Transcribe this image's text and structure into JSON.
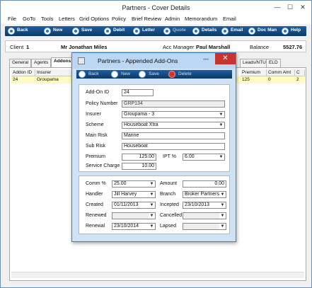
{
  "main_window": {
    "title": "Partners - Cover Details",
    "minimize_glyph": "—",
    "maximize_glyph": "☐",
    "close_glyph": "✕"
  },
  "menubar": [
    "File",
    "GoTo",
    "Tools",
    "Letters",
    "Grid Options",
    "Policy",
    "Brief Review",
    "Admin",
    "Memorandum",
    "Email"
  ],
  "toolbar": {
    "back": "Back",
    "new": "New",
    "save": "Save",
    "debit": "Debit",
    "letter": "Letter",
    "quote": "Quote",
    "details": "Details",
    "email": "Email",
    "doc_man": "Doc Man",
    "help": "Help"
  },
  "client_bar": {
    "client_label": "Client",
    "client_no": "1",
    "client_name": "Mr Jonathan Miles",
    "acc_manager_label": "Acc Manager",
    "acc_manager": "Paul Marshall",
    "balance_label": "Balance",
    "balance": "5527.76"
  },
  "tabs": {
    "general": "General",
    "agents": "Agents",
    "addons": "Addons",
    "leads": "Leads/NTU",
    "eld": "ELD"
  },
  "grid": {
    "headers": [
      "Addon ID",
      "Insurer",
      "Premium",
      "Comm Amt",
      "C"
    ],
    "row": [
      "24",
      "Groupama",
      "125",
      "0",
      "2"
    ]
  },
  "dialog": {
    "title": "Partners - Appended Add-Ons",
    "minimize_glyph": "—",
    "close_glyph": "✕",
    "toolbar": {
      "back": "Back",
      "new": "New",
      "save": "Save",
      "delete": "Delete"
    },
    "labels": {
      "addon_id": "Add-On ID",
      "policy_number": "Policy Number",
      "insurer": "Insurer",
      "scheme": "Scheme",
      "main_risk": "Main Risk",
      "sub_risk": "Sub Risk",
      "premium": "Premium",
      "ipt": "IPT %",
      "service_charge": "Service Charge",
      "comm_pct": "Comm %",
      "amount": "Amount",
      "handler": "Handler",
      "branch": "Branch",
      "created": "Created",
      "incepted": "Incepted",
      "renewed": "Renewed",
      "cancelled": "Cancelled",
      "renewal": "Renewal",
      "lapsed": "Lapsed"
    },
    "values": {
      "addon_id": "24",
      "policy_number": "GRP134",
      "insurer": "Groupama - 3",
      "scheme": "Houseboat Xtra",
      "main_risk": "Marine",
      "sub_risk": "Houseboat",
      "premium": "125.00",
      "ipt": "6.00",
      "service_charge": "10.00",
      "comm_pct": "25.00",
      "amount": "0.00",
      "handler": "Jill Harvey",
      "branch": "Broker Partners L",
      "created": "01/11/2013",
      "incepted": "23/10/2013",
      "renewed": "",
      "cancelled": "",
      "renewal": "23/10/2014",
      "lapsed": ""
    },
    "combo_arrow": "▼"
  }
}
